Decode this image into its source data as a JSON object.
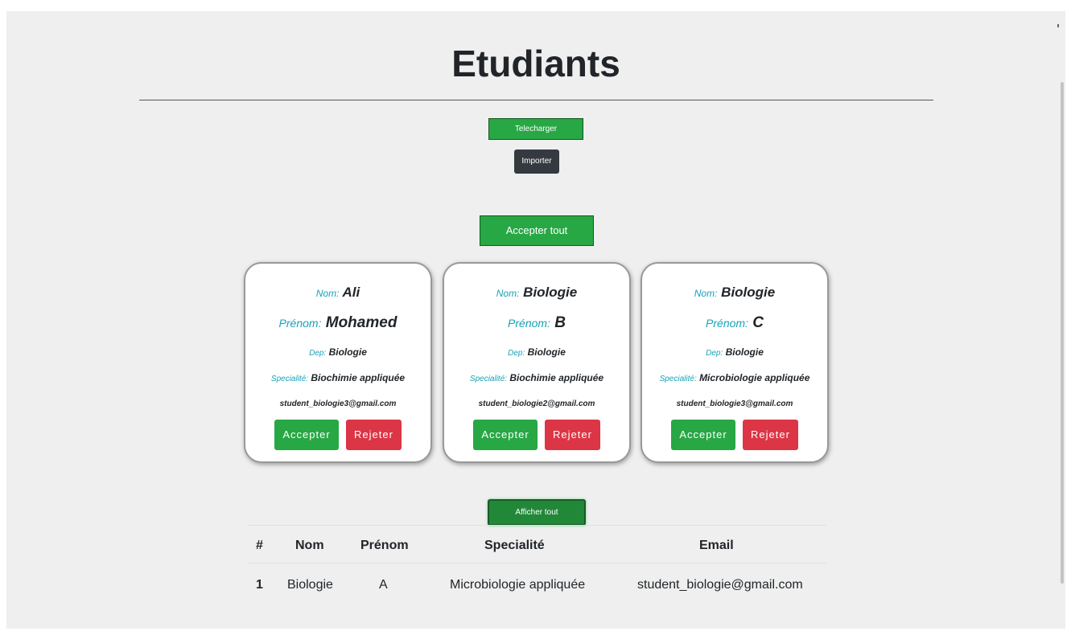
{
  "page": {
    "title": "Etudiants",
    "download_label": "Telecharger",
    "import_label": "Importer",
    "accept_all_label": "Accepter tout",
    "show_all_label": "Afficher tout"
  },
  "labels": {
    "nom": "Nom:",
    "prenom": "Prénom:",
    "dep": "Dep:",
    "specialite": "Specialité:",
    "accept": "Accepter",
    "reject": "Rejeter"
  },
  "cards": [
    {
      "nom": "Ali",
      "prenom": "Mohamed",
      "dep": "Biologie",
      "specialite": "Biochimie appliquée",
      "email": "student_biologie3@gmail.com"
    },
    {
      "nom": "Biologie",
      "prenom": "B",
      "dep": "Biologie",
      "specialite": "Biochimie appliquée",
      "email": "student_biologie2@gmail.com"
    },
    {
      "nom": "Biologie",
      "prenom": "C",
      "dep": "Biologie",
      "specialite": "Microbiologie appliquée",
      "email": "student_biologie3@gmail.com"
    }
  ],
  "table": {
    "headers": {
      "index": "#",
      "nom": "Nom",
      "prenom": "Prénom",
      "specialite": "Specialité",
      "email": "Email"
    },
    "rows": [
      {
        "index": "1",
        "nom": "Biologie",
        "prenom": "A",
        "specialite": "Microbiologie appliquée",
        "email": "student_biologie@gmail.com"
      }
    ]
  },
  "colors": {
    "success": "#28a745",
    "danger": "#dc3545",
    "dark": "#343a40",
    "info": "#17a2b8"
  }
}
